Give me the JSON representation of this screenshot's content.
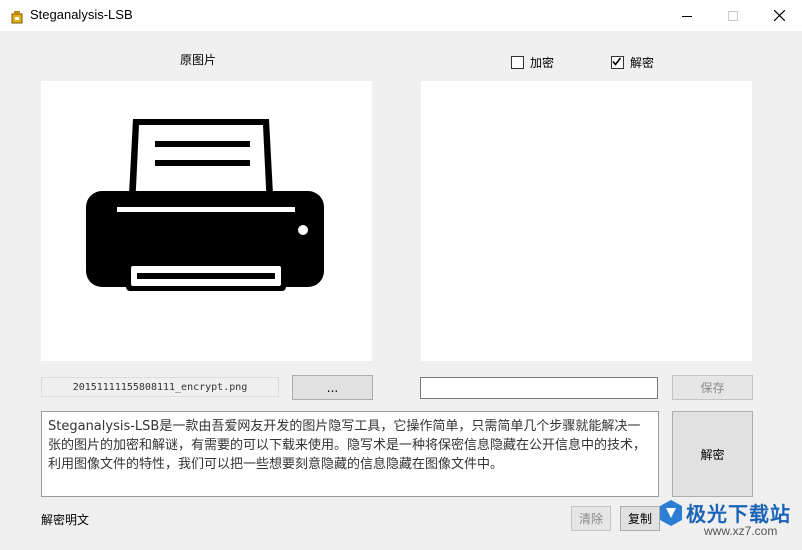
{
  "window": {
    "title": "Steganalysis-LSB"
  },
  "labels": {
    "original_image": "原图片",
    "decrypted_text": "解密明文"
  },
  "mode": {
    "encrypt": {
      "label": "加密",
      "checked": false
    },
    "decrypt": {
      "label": "解密",
      "checked": true
    }
  },
  "file": {
    "name": "20151111155808111_encrypt.png",
    "browse_label": "..."
  },
  "output": {
    "path_value": "",
    "save_label": "保存"
  },
  "actions": {
    "decrypt_label": "解密",
    "clear_label": "清除",
    "copy_label": "复制"
  },
  "message": {
    "text": "Steganalysis-LSB是一款由吾爱网友开发的图片隐写工具，它操作简单，只需简单几个步骤就能解决一张的图片的加密和解谜，有需要的可以下载来使用。隐写术是一种将保密信息隐藏在公开信息中的技术，利用图像文件的特性，我们可以把一些想要刻意隐藏的信息隐藏在图像文件中。"
  },
  "watermark": {
    "text": "极光下载站",
    "url": "www.xz7.com"
  },
  "icons": [
    "app-icon",
    "minimize-icon",
    "maximize-icon",
    "close-icon",
    "printer-icon",
    "checkmark-icon",
    "watermark-logo-icon"
  ]
}
